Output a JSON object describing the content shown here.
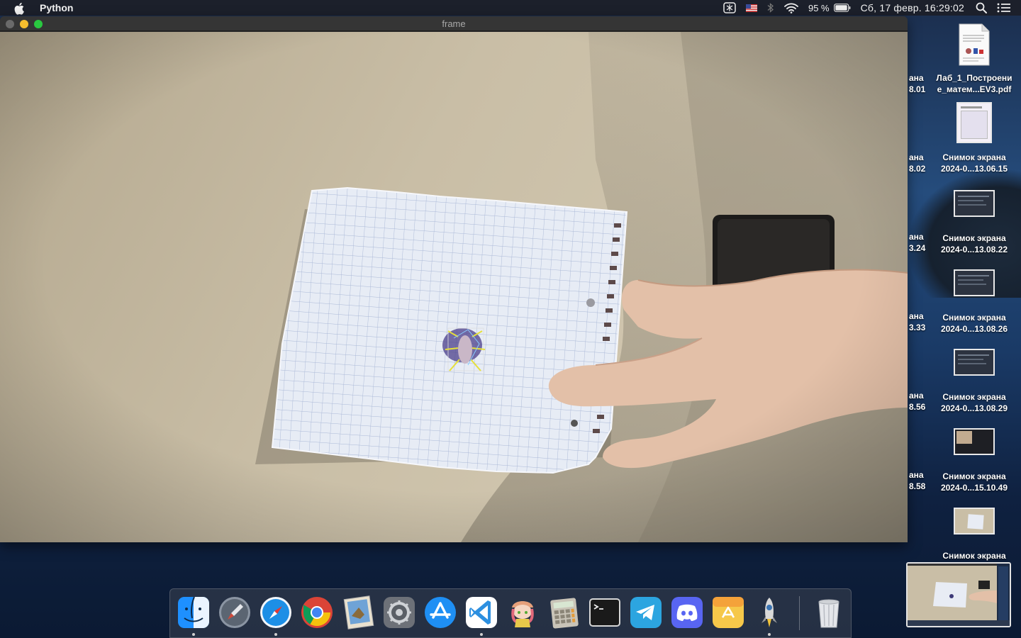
{
  "menubar": {
    "app_name": "Python",
    "battery_percent": "95 %",
    "datetime": "Сб, 17 февр.  16:29:02",
    "icons": [
      "apple-icon",
      "screen-capture-icon",
      "us-flag-icon",
      "bluetooth-icon",
      "wifi-icon",
      "battery-icon",
      "spotlight-search-icon",
      "control-center-icon"
    ]
  },
  "window": {
    "title": "frame"
  },
  "desktop": {
    "items": [
      {
        "line1": "Лаб_1_Построени",
        "line2": "е_матем...EV3.pdf",
        "cut_line1": "ана",
        "cut_line2": "8.01"
      },
      {
        "line1": "Снимок экрана",
        "line2": "2024-0...13.06.15",
        "cut_line1": "ана",
        "cut_line2": "8.02"
      },
      {
        "line1": "Снимок экрана",
        "line2": "2024-0...13.08.22",
        "cut_line1": "ана",
        "cut_line2": "3.24"
      },
      {
        "line1": "Снимок экрана",
        "line2": "2024-0...13.08.26",
        "cut_line1": "ана",
        "cut_line2": "3.33"
      },
      {
        "line1": "Снимок экрана",
        "line2": "2024-0...13.08.29",
        "cut_line1": "ана",
        "cut_line2": "8.56"
      },
      {
        "line1": "Снимок экрана",
        "line2": "2024-0...15.10.49",
        "cut_line1": "ана",
        "cut_line2": "8.58"
      },
      {
        "line1": "Снимок экрана",
        "line2": "",
        "cut_line1": "",
        "cut_line2": ""
      }
    ]
  },
  "dock": {
    "apps": [
      "Finder",
      "Launchpad",
      "Safari",
      "Google Chrome",
      "Preview",
      "System Preferences",
      "App Store",
      "Visual Studio Code",
      "Anime Character",
      "Calculator",
      "Terminal",
      "Telegram",
      "Discord",
      "Recycle Utility",
      "Python Launcher",
      "Trash"
    ]
  }
}
